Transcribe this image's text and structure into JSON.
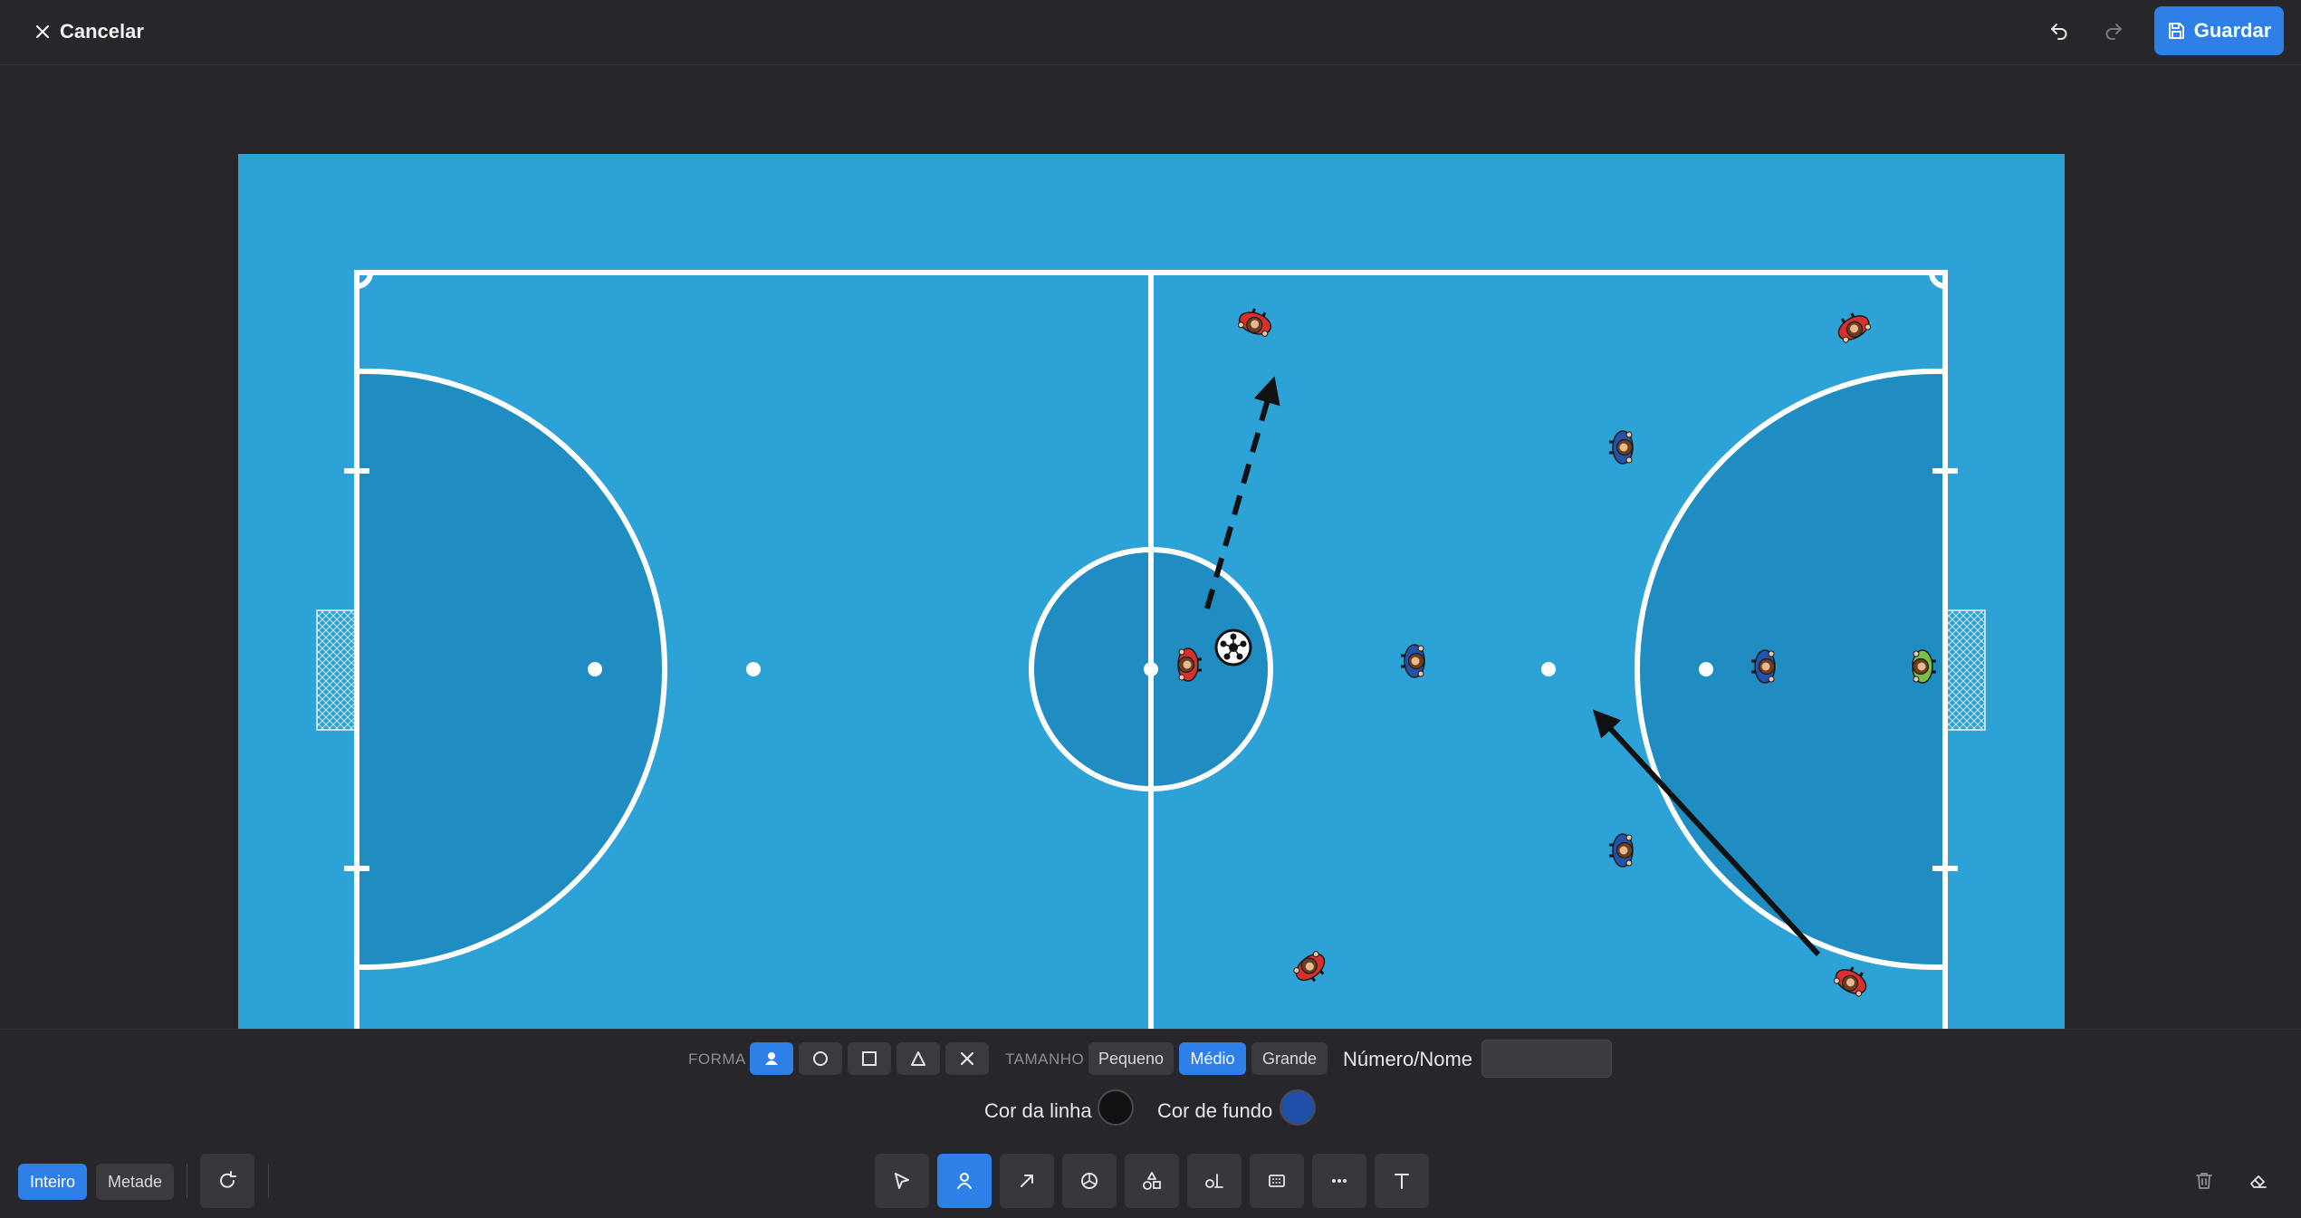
{
  "header": {
    "cancel_label": "Cancelar",
    "save_label": "Guardar"
  },
  "properties": {
    "shape_label": "FORMA",
    "size_label": "TAMANHO",
    "sizes": [
      "Pequeno",
      "Médio",
      "Grande"
    ],
    "selected_size": "Médio",
    "number_label": "Número/Nome",
    "number_value": "",
    "line_color_label": "Cor da linha",
    "line_color": "#111111",
    "fill_color_label": "Cor de fundo",
    "fill_color": "#1f4fa8"
  },
  "view": {
    "full_label": "Inteiro",
    "half_label": "Metade",
    "selected": "Inteiro"
  },
  "tools": [
    "select-icon",
    "player-icon",
    "arrow-icon",
    "ball-icon",
    "equipment-icon",
    "goal-icon",
    "grid-icon",
    "dots-icon",
    "text-icon"
  ],
  "colors": {
    "pitch_surround": "#2ca2d6",
    "penalty_area": "#1f8cc2",
    "accent": "#2f7fe8",
    "team_red": "#d9302e",
    "team_blue": "#2352a8",
    "goalkeeper": "#7bc043"
  }
}
